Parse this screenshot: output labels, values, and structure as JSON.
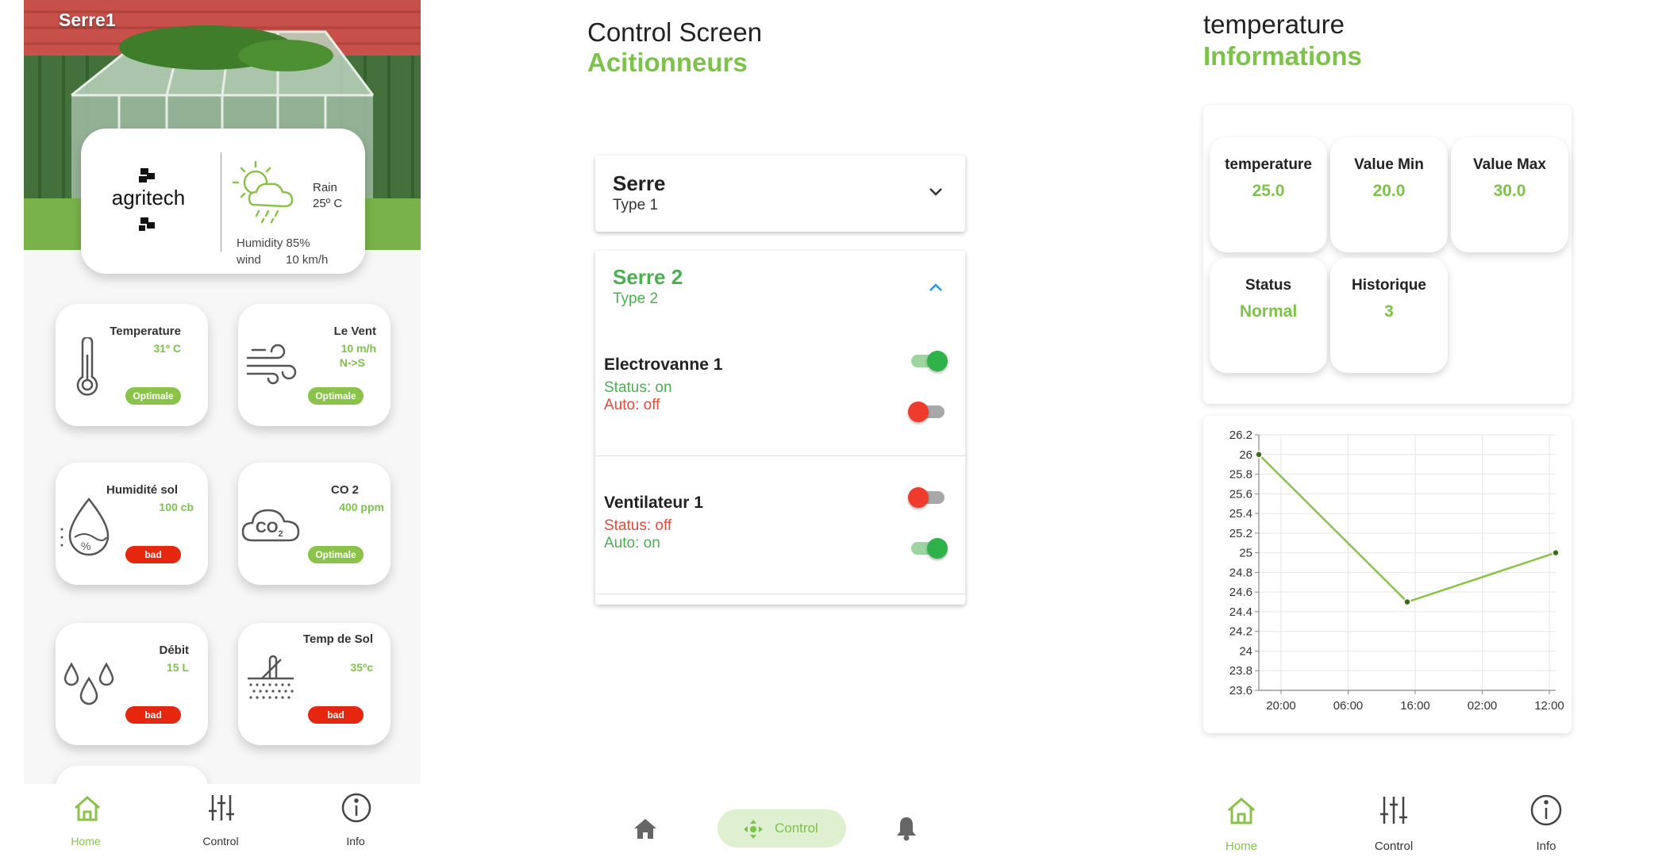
{
  "home": {
    "title": "Serre1",
    "brand": "agritech",
    "weather": {
      "condition": "Rain",
      "temperature": "25º C",
      "humidity": "Humidity 85%",
      "wind_label": "wind",
      "wind_value": "10 km/h",
      "icon": "cloud-sun-icon"
    },
    "tiles": [
      {
        "label": "Temperature",
        "value": "31º C",
        "value2": "",
        "status": "Optimale",
        "status_color": "#8bc34a",
        "icon": "thermometer-icon"
      },
      {
        "label": "Le Vent",
        "value": "10 m/h",
        "value2": "N->S",
        "status": "Optimale",
        "status_color": "#8bc34a",
        "icon": "wind-icon"
      },
      {
        "label": "Humidité sol",
        "value": "100 cb",
        "value2": "",
        "status": "bad",
        "status_color": "#e6270f",
        "icon": "soil-humidity-icon"
      },
      {
        "label": "CO 2",
        "value": "400 ppm",
        "value2": "",
        "status": "Optimale",
        "status_color": "#8bc34a",
        "icon": "co2-cloud-icon"
      },
      {
        "label": "Débit",
        "value": "15 L",
        "value2": "",
        "status": "bad",
        "status_color": "#e6270f",
        "icon": "water-drops-icon"
      },
      {
        "label": "Temp de Sol",
        "value": "35ºc",
        "value2": "",
        "status": "bad",
        "status_color": "#e6270f",
        "icon": "soil-temperature-icon"
      }
    ],
    "co2_glyph": "CO",
    "co2_sub": "2",
    "nav": [
      {
        "label": "Home",
        "icon": "home-icon",
        "active": true
      },
      {
        "label": "Control",
        "icon": "sliders-icon",
        "active": false
      },
      {
        "label": "Info",
        "icon": "info-icon",
        "active": false
      }
    ]
  },
  "control": {
    "title": "Control Screen",
    "subtitle": "Acitionneurs",
    "groups": [
      {
        "name": "Serre",
        "type": "Type 1",
        "expanded": false
      },
      {
        "name": "Serre 2",
        "type": "Type 2",
        "expanded": true,
        "actuators": [
          {
            "name": "Electrovanne 1",
            "status": "Status: on",
            "auto": "Auto: off",
            "status_on": true,
            "auto_on": false
          },
          {
            "name": "Ventilateur 1",
            "status": "Status: off",
            "auto": "Auto: on",
            "status_on": false,
            "auto_on": true
          }
        ]
      }
    ],
    "nav": [
      {
        "label": "",
        "icon": "home-icon"
      },
      {
        "label": "Control",
        "icon": "control-move-icon",
        "active": true
      },
      {
        "label": "",
        "icon": "bell-icon"
      }
    ]
  },
  "info": {
    "title": "temperature",
    "subtitle": "Informations",
    "stats": [
      {
        "label": "temperature",
        "value": "25.0"
      },
      {
        "label": "Value Min",
        "value": "20.0"
      },
      {
        "label": "Value Max",
        "value": "30.0"
      },
      {
        "label": "Status",
        "value": "Normal"
      },
      {
        "label": "Historique",
        "value": "3"
      }
    ],
    "nav": [
      {
        "label": "Home",
        "icon": "home-icon",
        "active": true
      },
      {
        "label": "Control",
        "icon": "sliders-icon",
        "active": false
      },
      {
        "label": "Info",
        "icon": "info-icon",
        "active": false
      }
    ]
  },
  "colors": {
    "accent": "#7cc34a",
    "green": "#4caf50",
    "red": "#e6270f"
  },
  "chart_data": {
    "type": "line",
    "x": [
      "20:00",
      "16:00",
      "12:00"
    ],
    "x_ticks": [
      "20:00",
      "06:00",
      "16:00",
      "02:00",
      "12:00"
    ],
    "series": [
      {
        "values": [
          26,
          24.5,
          25
        ]
      }
    ],
    "y_ticks": [
      "26.2",
      "26",
      "25.8",
      "25.6",
      "25.4",
      "25.2",
      "25",
      "24.8",
      "24.6",
      "24.4",
      "24.2",
      "24",
      "23.8",
      "23.6"
    ],
    "ylim": [
      23.6,
      26.2
    ],
    "grid": true,
    "line_color": "#8bc34a"
  }
}
